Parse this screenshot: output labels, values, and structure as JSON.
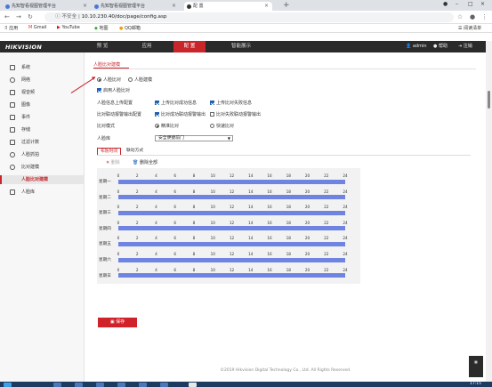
{
  "browser": {
    "tabs": [
      {
        "label": "先知智看视图管理平台",
        "active": false
      },
      {
        "label": "先知智看视图管理平台",
        "active": false
      },
      {
        "label": "配 置",
        "active": true
      }
    ],
    "security_label": "不安全",
    "url": "10.10.230.40/doc/page/config.asp",
    "bookmarks": [
      "应用",
      "Gmail",
      "YouTube",
      "地图",
      "QQ邮箱"
    ],
    "reading_list": "阅读清单"
  },
  "app": {
    "logo": "HIKVISION",
    "nav": [
      {
        "label": "预 览",
        "active": false
      },
      {
        "label": "应用",
        "active": false
      },
      {
        "label": "配 置",
        "active": true
      },
      {
        "label": "智能展示",
        "active": false
      }
    ],
    "user": "admin",
    "help": "帮助",
    "logout": "注销"
  },
  "sidebar": {
    "items": [
      {
        "label": "系统",
        "icon": "monitor-icon",
        "active": false
      },
      {
        "label": "网络",
        "icon": "globe-icon",
        "active": false
      },
      {
        "label": "视音频",
        "icon": "video-icon",
        "active": false
      },
      {
        "label": "图像",
        "icon": "image-icon",
        "active": false
      },
      {
        "label": "事件",
        "icon": "calendar-icon",
        "active": false
      },
      {
        "label": "存储",
        "icon": "storage-icon",
        "active": false
      },
      {
        "label": "过滤计数",
        "icon": "filter-icon",
        "active": false
      },
      {
        "label": "人脸抓拍",
        "icon": "face-icon",
        "active": false
      },
      {
        "label": "比对建模",
        "icon": "model-icon",
        "active": false
      },
      {
        "label": "人脸比对建模",
        "icon": "",
        "active": true
      },
      {
        "label": "人脸库",
        "icon": "database-icon",
        "active": false
      }
    ]
  },
  "config": {
    "section_tab": "人脸比对建模",
    "mode_options": [
      "人脸比对",
      "人脸建模"
    ],
    "enable_label": "启用人脸比对",
    "row1": [
      "人脸信息上传配置",
      "上传比对成功信息",
      "上传比对失败信息"
    ],
    "row2": [
      "比对联动报警输出配置",
      "比对成功联动报警输出",
      "比对失败联动报警输出"
    ],
    "compare_mode_label": "比对模式",
    "compare_options": [
      "精准比对",
      "快速比对"
    ],
    "face_lib_label": "人脸库",
    "face_lib_value": "安全便捷前门",
    "subtabs": [
      "布防时间",
      "联动方式"
    ],
    "delete_label": "删除",
    "delete_all_label": "删除全部",
    "days": [
      "星期一",
      "星期二",
      "星期三",
      "星期四",
      "星期五",
      "星期六",
      "星期日"
    ],
    "hours": [
      "0",
      "2",
      "4",
      "6",
      "8",
      "10",
      "12",
      "14",
      "16",
      "18",
      "20",
      "22",
      "24"
    ],
    "schedule_coverage": "0-24",
    "save_label": "保存",
    "footer": "©2019 Hikvision Digital Technology Co., Ltd. All Rights Reserved."
  },
  "taskbar": {
    "time": "17:15"
  },
  "colors": {
    "accent": "#c8262b",
    "schedule_bar": "#6f84e0",
    "header": "#2a2a2a"
  }
}
